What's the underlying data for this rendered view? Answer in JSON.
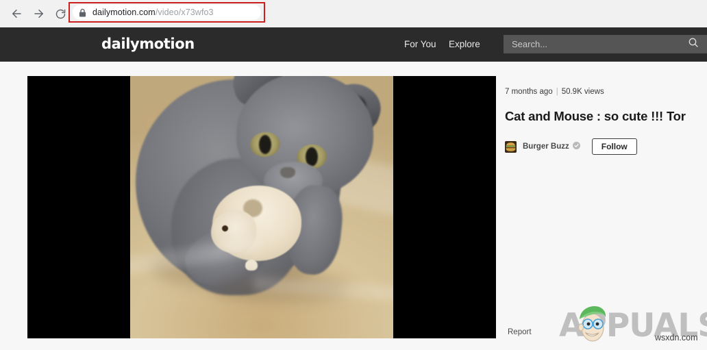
{
  "browser": {
    "back_icon": "arrow-left-icon",
    "forward_icon": "arrow-right-icon",
    "reload_icon": "reload-icon",
    "lock_icon": "padlock-icon",
    "url_domain": "dailymotion.com",
    "url_path": "/video/x73wfo3",
    "highlight_color": "#cc1f1f",
    "chrome_bg": "#f1f1f1"
  },
  "header": {
    "logo": "dailymotion",
    "bg_color": "#2b2b2b",
    "nav": [
      {
        "label": "For You"
      },
      {
        "label": "Explore"
      }
    ],
    "search": {
      "placeholder": "Search...",
      "value": "",
      "icon": "search-icon",
      "bg_color": "#555555"
    }
  },
  "video": {
    "player_state": "paused",
    "pillarbox_color": "#000000",
    "content_description": "gray kitten holding a white hamster on a tan blanket"
  },
  "meta": {
    "published": "7 months ago",
    "separator": "|",
    "views": "50.9K views",
    "title": "Cat and Mouse : so cute !!! Tor",
    "channel": {
      "name": "Burger Buzz",
      "avatar_icon": "burger-icon",
      "verified_icon": "verified-check-icon"
    },
    "follow_label": "Follow",
    "report_label": "Report"
  },
  "watermark": {
    "brand": "APPUALS",
    "mascot_icon": "appuals-mascot-icon",
    "site": "wsxdn.com"
  }
}
